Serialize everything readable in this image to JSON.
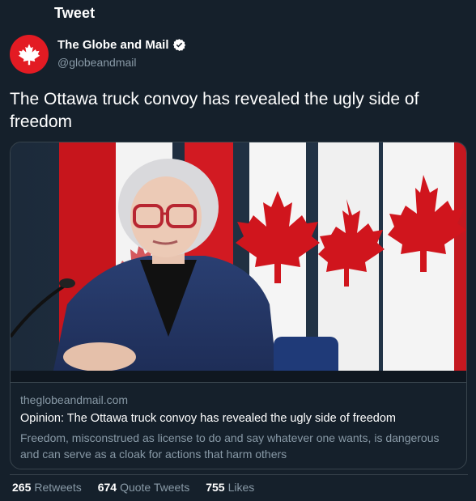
{
  "header": {
    "title": "Tweet"
  },
  "author": {
    "name": "The Globe and Mail",
    "handle": "@globeandmail",
    "verified": true,
    "avatar_color": "#e31b23"
  },
  "tweet": {
    "text": "The Ottawa truck convoy has revealed the ugly side of freedom"
  },
  "card": {
    "domain": "theglobeandmail.com",
    "title": "Opinion: The Ottawa truck convoy has revealed the ugly side of freedom",
    "description": "Freedom, misconstrued as license to do and say whatever one wants, is dangerous and can serve as a cloak for actions that harm others"
  },
  "stats": [
    {
      "count": "265",
      "label": "Retweets"
    },
    {
      "count": "674",
      "label": "Quote Tweets"
    },
    {
      "count": "755",
      "label": "Likes"
    }
  ],
  "colors": {
    "background": "#15202b",
    "secondary_text": "#8899a6",
    "border": "#38444d",
    "verified_badge": "#ffffff"
  }
}
